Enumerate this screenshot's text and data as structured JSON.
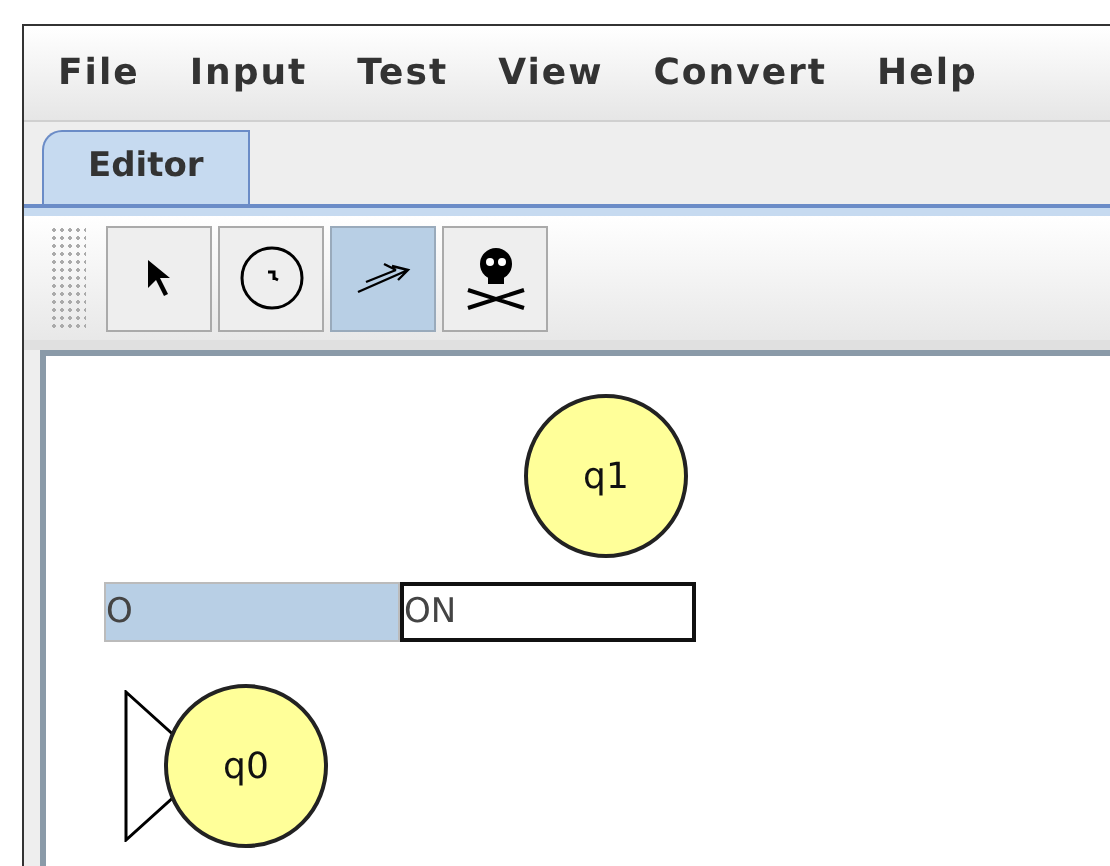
{
  "menu": [
    "File",
    "Input",
    "Test",
    "View",
    "Convert",
    "Help"
  ],
  "tabs": [
    {
      "label": "Editor",
      "selected": true
    }
  ],
  "tools": [
    {
      "kind": "pointer",
      "selected": false
    },
    {
      "kind": "state",
      "selected": false
    },
    {
      "kind": "transition",
      "selected": true
    },
    {
      "kind": "delete",
      "selected": false
    }
  ],
  "canvas": {
    "states": [
      {
        "label": "q1",
        "initial": false
      },
      {
        "label": "q0",
        "initial": true
      }
    ],
    "label_editor": [
      {
        "text": "O",
        "selected": true
      },
      {
        "text": "ON",
        "selected": false
      }
    ]
  }
}
